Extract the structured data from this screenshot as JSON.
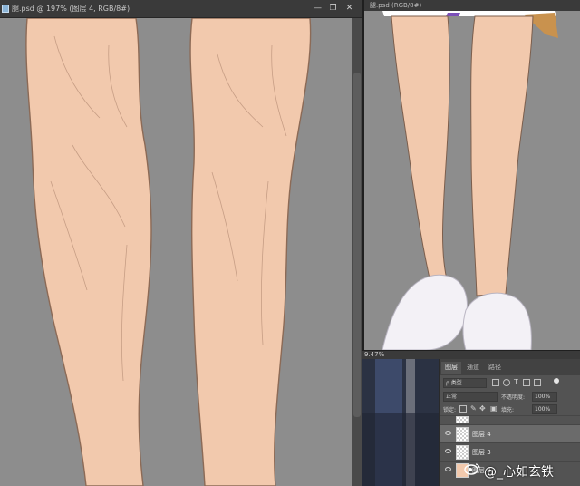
{
  "main_window": {
    "title": "腿.psd @ 197% (图层 4, RGB/8#)",
    "minimize_glyph": "—",
    "restore_glyph": "❐",
    "close_glyph": "✕"
  },
  "navigator": {
    "title": "腿.psd (RGB/8#)",
    "zoom": "9.47%"
  },
  "layers_panel": {
    "tabs": [
      "图层",
      "通道",
      "路径"
    ],
    "active_tab": "图层",
    "filter_kind": "ρ 类型",
    "blend_mode": "正常",
    "opacity_label": "不透明度:",
    "opacity_value": "100%",
    "lock_label": "锁定:",
    "fill_label": "填充:",
    "fill_value": "100%",
    "layers": [
      {
        "name": "图层 4",
        "selected": true
      },
      {
        "name": "图层 3",
        "selected": false
      },
      {
        "name": "图层 2",
        "selected": false
      }
    ]
  },
  "watermark": "@_心如玄铁",
  "colors": {
    "skin": "#f2c9ad",
    "canvas_bg": "#8d8d8d",
    "shoe": "#f3f1f6"
  }
}
